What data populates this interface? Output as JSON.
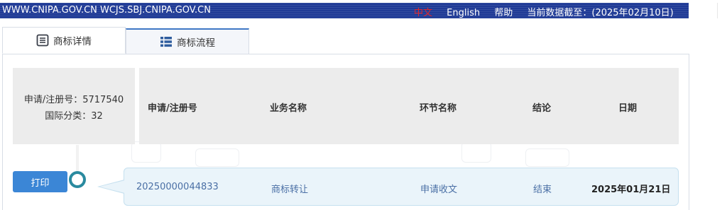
{
  "topbar": {
    "site_links": "WWW.CNIPA.GOV.CN WCJS.SBJ.CNIPA.GOV.CN",
    "lang_zh": "中文",
    "lang_en": "English",
    "help": "帮助",
    "data_date": "当前数据截至：(2025年02月10日)"
  },
  "tabs": [
    {
      "label": "商标详情",
      "icon": "document-icon"
    },
    {
      "label": "商标流程",
      "icon": "list-icon"
    }
  ],
  "info": {
    "reg_no": "申请/注册号：5717540",
    "intl_class": "国际分类：32"
  },
  "table": {
    "headers": [
      "申请/注册号",
      "业务名称",
      "环节名称",
      "结论",
      "日期"
    ],
    "rows": [
      {
        "reg_no": "20250000044833",
        "business": "商标转让",
        "stage": "申请收文",
        "result": "结束",
        "date": "2025年01月21日"
      }
    ]
  },
  "actions": {
    "print": "打印"
  },
  "colors": {
    "topbar": "#1f3a96",
    "accent": "#3b86d6",
    "link": "#4a6fa5",
    "zh_active": "#e0282d"
  }
}
